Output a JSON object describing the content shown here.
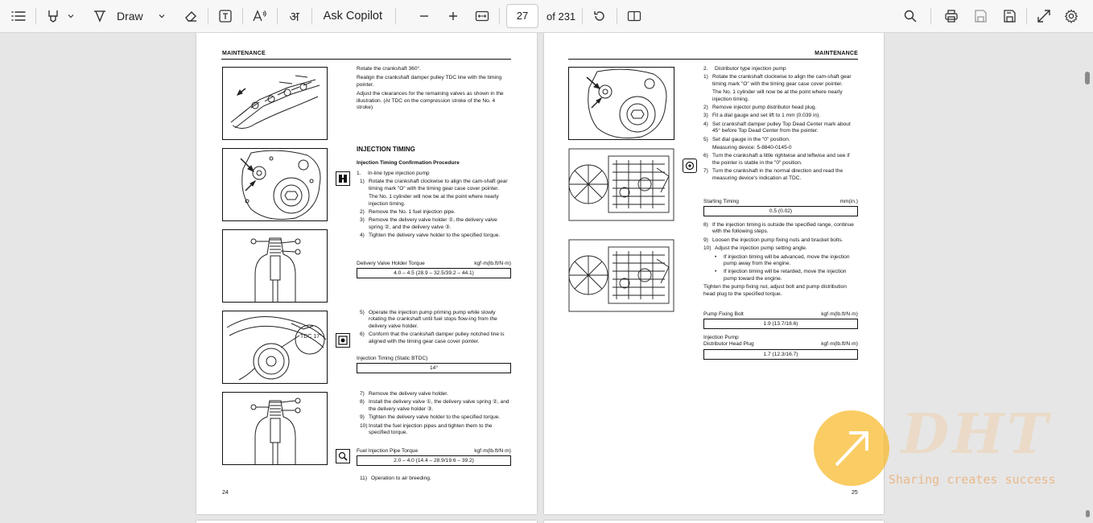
{
  "toolbar": {
    "draw_label": "Draw",
    "ask_copilot_label": "Ask Copilot",
    "current_page": "27",
    "total_pages": "of 231"
  },
  "left_page": {
    "header": "MAINTENANCE",
    "intro": [
      "Rotate the crankshaft 360°.",
      "Realign the crankshaft damper pulley TDC line with the timing pointer.",
      "Adjust the clearances for the remaining valves as shown in the illustration. (At TDC on the compression stroke of the No. 4 stroke)"
    ],
    "section_title": "INJECTION TIMING",
    "subsection_title": "Injection Timing Confirmation Procedure",
    "step_1": "In-line type injection pump",
    "steps_a": [
      {
        "n": "1)",
        "t": "Rotate the crankshaft clockwise to align the cam-shaft gear timing mark \"O\" with the timing gear case cover pointer."
      },
      {
        "n": "",
        "t": "The No. 1 cylinder will now be at the point where nearly injection timing."
      },
      {
        "n": "2)",
        "t": "Remove the No. 1 fuel injection pipe."
      },
      {
        "n": "3)",
        "t": "Remove the delivery valve holder ①, the delivery valve spring ②, and the delivery valve ③."
      },
      {
        "n": "4)",
        "t": "Tighten the delivery valve holder to the specified torque."
      }
    ],
    "spec1_label": "Delivery Valve Holder Torque",
    "spec1_unit": "kgf·m(lb.ft/N·m)",
    "spec1_value": "4.0 – 4.5 (28.9 – 32.5/39.2 – 44.1)",
    "steps_b": [
      {
        "n": "5)",
        "t": "Operate the injection pump priming pump while slowly rotating the crankshaft until fuel stops flow-ing from the delivery valve holder."
      },
      {
        "n": "6)",
        "t": "Conform that the crankshaft damper pulley notched line is aligned with the timing gear case cover pointer."
      }
    ],
    "spec2_label": "Injection Timing (Static BTDC)",
    "spec2_value": "14°",
    "steps_c": [
      {
        "n": "7)",
        "t": "Remove the delivery valve holder."
      },
      {
        "n": "8)",
        "t": "Install the delivery valve ①, the delivery valve spring ②, and the delivery valve holder ③."
      },
      {
        "n": "9)",
        "t": "Tighten the delivery valve holder to the specified torque."
      },
      {
        "n": "10)",
        "t": "Install the fuel injection pipes and tighten them to the specified torque."
      }
    ],
    "spec3_label": "Fuel Injection Pipe Torque",
    "spec3_unit": "kgf·m(lb.ft/N·m)",
    "spec3_value": "2.0 – 4.0 (14.4 – 28.9/19.6 – 39.2)",
    "step_11": "Operation to air breeding.",
    "page_number": "24"
  },
  "right_page": {
    "header": "MAINTENANCE",
    "step_2": "Distributor type injection pump",
    "steps_a": [
      {
        "n": "1)",
        "t": "Rotate the crankshaft clockwise to align the cam-shaft gear timing mark \"O\" with the timing gear case cover pointer."
      },
      {
        "n": "",
        "t": "The No. 1 cylinder will now be at the point where nearly injection timing."
      },
      {
        "n": "2)",
        "t": "Remove injector pump distributor head plug."
      },
      {
        "n": "3)",
        "t": "Fit a dial gauge and set lift to 1 mm (0.039 in)."
      },
      {
        "n": "4)",
        "t": "Set crankshaft damper pulley Top Dead Center mark about 45° before Top Dead Center from the pointer."
      },
      {
        "n": "5)",
        "t": "Set dial gauge in the \"0\" position."
      },
      {
        "n": "",
        "t": "Measuring device: 5-8840-0145-0"
      },
      {
        "n": "6)",
        "t": "Turn the crankshaft a little rightwise and leftwise and see if the pointer is stable in the \"0\" position."
      },
      {
        "n": "7)",
        "t": "Turn the crankshaft in the normal direction and read the measuring device's indication at TDC."
      }
    ],
    "spec1_label": "Starting Timing",
    "spec1_unit": "mm(in.)",
    "spec1_value": "0.5 (0.02)",
    "steps_b": [
      {
        "n": "8)",
        "t": "If the injection timing is outside the specified range, continue with the following steps."
      },
      {
        "n": "9)",
        "t": "Loosen the injection pump fixing nuts and bracket bolts."
      },
      {
        "n": "10)",
        "t": "Adjust the injection pump setting angle."
      }
    ],
    "bullets": [
      "If injection timing will be advanced, move the injection pump away from the engine.",
      "If injection timing will be retarded, move the injection pump toward the engine."
    ],
    "closing": "Tighten the pump fixing nut, adjust bolt and pump distribution head plug to the specified torque.",
    "spec2_label": "Pump Fixing Bolt",
    "spec2_unit": "kgf·m(lb.ft/N·m)",
    "spec2_value": "1.9 (13.7/18.6)",
    "spec3_label_1": "Injection Pump",
    "spec3_label_2": "Distributor Head Plug",
    "spec3_unit": "kgf·m(lb.ft/N·m)",
    "spec3_value": "1.7 (12.3/16.7)",
    "page_number": "25"
  },
  "watermark": {
    "brand": "DHT",
    "tagline": "Sharing creates success"
  }
}
